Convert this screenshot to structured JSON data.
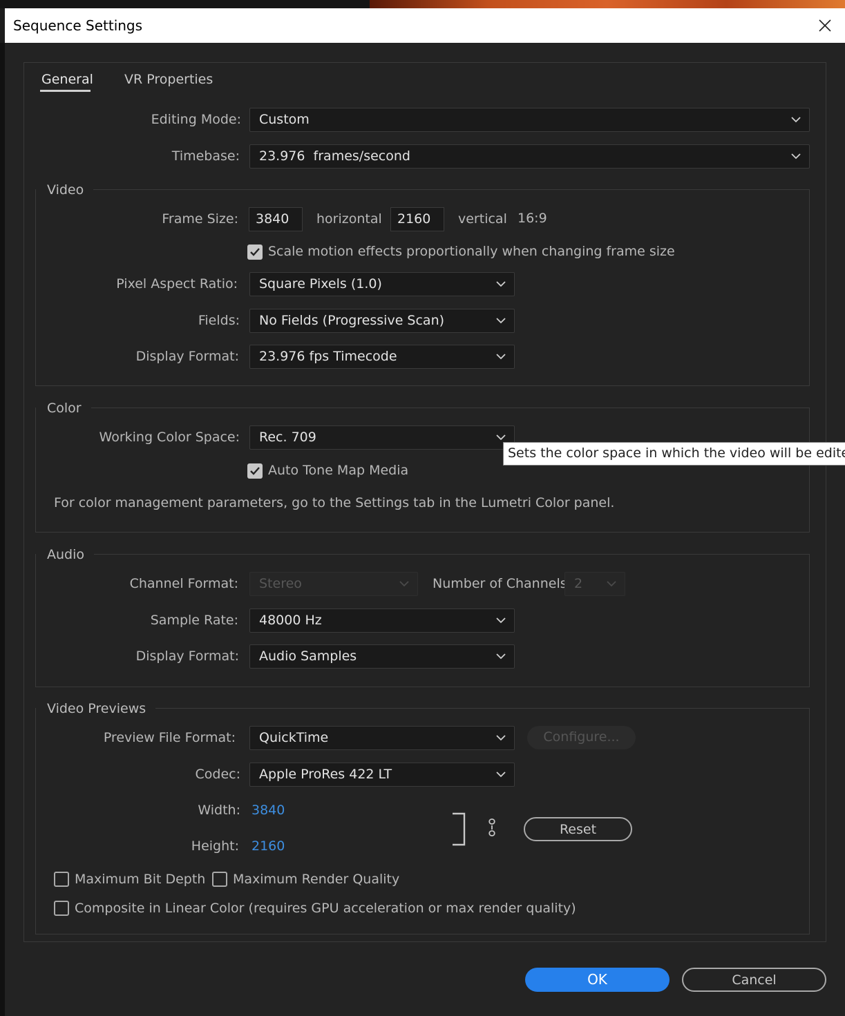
{
  "window": {
    "title": "Sequence Settings"
  },
  "tabs": [
    {
      "label": "General"
    },
    {
      "label": "VR Properties"
    }
  ],
  "general": {
    "editing_mode": {
      "label": "Editing Mode:",
      "value": "Custom"
    },
    "timebase": {
      "label": "Timebase:",
      "value": "23.976  frames/second"
    }
  },
  "video": {
    "title": "Video",
    "frame_size": {
      "label": "Frame Size:",
      "horizontal": "3840",
      "horizontal_label": "horizontal",
      "vertical": "2160",
      "vertical_label": "vertical",
      "aspect": "16:9"
    },
    "scale_motion": {
      "label": "Scale motion effects proportionally when changing frame size",
      "checked": true
    },
    "pixel_aspect": {
      "label": "Pixel Aspect Ratio:",
      "value": "Square Pixels (1.0)"
    },
    "fields": {
      "label": "Fields:",
      "value": "No Fields (Progressive Scan)"
    },
    "display_format": {
      "label": "Display Format:",
      "value": "23.976 fps Timecode"
    }
  },
  "color": {
    "title": "Color",
    "working_color_space": {
      "label": "Working Color Space:",
      "value": "Rec. 709"
    },
    "auto_tone_map": {
      "label": "Auto Tone Map Media",
      "checked": true
    },
    "note": "For color management parameters, go to the Settings tab in the Lumetri Color panel.",
    "tooltip": "Sets the color space in which the video will be edited"
  },
  "audio": {
    "title": "Audio",
    "channel_format": {
      "label": "Channel Format:",
      "value": "Stereo",
      "disabled": true
    },
    "num_channels": {
      "label": "Number of Channels:",
      "value": "2",
      "disabled": true
    },
    "sample_rate": {
      "label": "Sample Rate:",
      "value": "48000 Hz"
    },
    "display_format": {
      "label": "Display Format:",
      "value": "Audio Samples"
    }
  },
  "previews": {
    "title": "Video Previews",
    "file_format": {
      "label": "Preview File Format:",
      "value": "QuickTime"
    },
    "configure_label": "Configure...",
    "codec": {
      "label": "Codec:",
      "value": "Apple ProRes 422 LT"
    },
    "width": {
      "label": "Width:",
      "value": "3840"
    },
    "height": {
      "label": "Height:",
      "value": "2160"
    },
    "reset_label": "Reset",
    "max_bit_depth": {
      "label": "Maximum Bit Depth",
      "checked": false
    },
    "max_render_quality": {
      "label": "Maximum Render Quality",
      "checked": false
    },
    "composite_linear": {
      "label": "Composite in Linear Color (requires GPU acceleration or max render quality)",
      "checked": false
    }
  },
  "buttons": {
    "ok": "OK",
    "cancel": "Cancel"
  },
  "colors": {
    "accent": "#2680eb",
    "link_value": "#3d8ee0",
    "dialog_bg": "#232323",
    "titlebar_bg": "#ffffff"
  },
  "icons": [
    "close-icon",
    "chevron-down-icon",
    "checkmark-icon",
    "link-icon"
  ]
}
